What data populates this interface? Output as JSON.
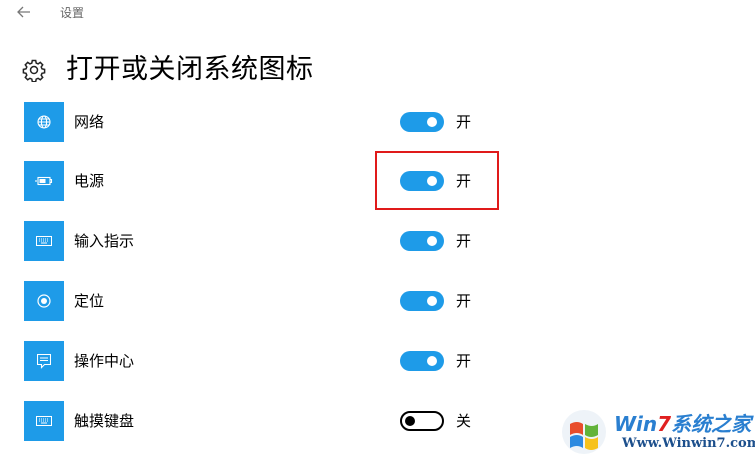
{
  "topbar": {
    "back_icon": "back-arrow-icon",
    "title": "设置"
  },
  "header": {
    "icon": "gear-icon",
    "title": "打开或关闭系统图标"
  },
  "items": [
    {
      "label": "网络",
      "icon": "globe-icon",
      "state": "开",
      "on": true
    },
    {
      "label": "电源",
      "icon": "battery-icon",
      "state": "开",
      "on": true
    },
    {
      "label": "输入指示",
      "icon": "keyboard-icon",
      "state": "开",
      "on": true
    },
    {
      "label": "定位",
      "icon": "location-icon",
      "state": "开",
      "on": true
    },
    {
      "label": "操作中心",
      "icon": "action-center-icon",
      "state": "开",
      "on": true
    },
    {
      "label": "触摸键盘",
      "icon": "touch-keyboard-icon",
      "state": "关",
      "on": false
    }
  ],
  "colors": {
    "accent": "#1e9be8",
    "highlight": "#e01a1a"
  },
  "watermark": {
    "brand_prefix": "Win",
    "brand_seven": "7",
    "brand_suffix": "系统之家",
    "url": "Www.Winwin7.com"
  }
}
